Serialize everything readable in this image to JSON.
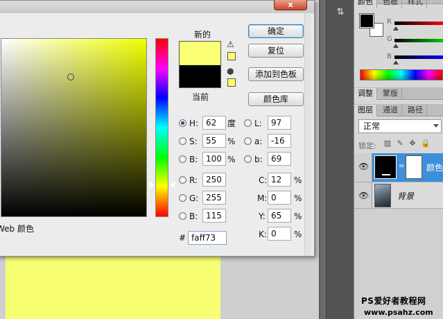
{
  "color_picker": {
    "close_label": "x",
    "new_label": "新的",
    "current_label": "当前",
    "new_color": "#faff73",
    "current_color": "#000000",
    "buttons": {
      "ok": "确定",
      "reset": "复位",
      "add_to_swatches": "添加到色板",
      "color_libraries": "颜色库"
    },
    "hsb": {
      "h_label": "H:",
      "h_value": "62",
      "h_unit": "度",
      "s_label": "S:",
      "s_value": "55",
      "s_unit": "%",
      "b_label": "B:",
      "b_value": "100",
      "b_unit": "%"
    },
    "rgb": {
      "r_label": "R:",
      "r_value": "250",
      "g_label": "G:",
      "g_value": "255",
      "b_label": "B:",
      "b_value": "115"
    },
    "lab": {
      "l_label": "L:",
      "l_value": "97",
      "a_label": "a:",
      "a_value": "-16",
      "b_label": "b:",
      "b_value": "69"
    },
    "cmyk": {
      "c_label": "C:",
      "c_value": "12",
      "c_unit": "%",
      "m_label": "M:",
      "m_value": "0",
      "m_unit": "%",
      "y_label": "Y:",
      "y_value": "65",
      "y_unit": "%",
      "k_label": "K:",
      "k_value": "0",
      "k_unit": "%"
    },
    "hex_label": "#",
    "hex_value": "faff73",
    "web_colors_label": "Web 颜色",
    "selected_mode": "H"
  },
  "panels": {
    "color_tabs": [
      "颜色",
      "色板",
      "样式"
    ],
    "channel_letters": [
      "R",
      "G",
      "B"
    ],
    "adjust_tabs": [
      "调整",
      "蒙版"
    ],
    "layer_tabs": [
      "图层",
      "通道",
      "路径"
    ],
    "blend_mode": "正常",
    "lock_label": "锁定:",
    "layers": [
      {
        "name": "颜色",
        "selected": true
      },
      {
        "name": "背景",
        "selected": false
      }
    ]
  },
  "watermark": {
    "title": "PS爱好者教程网",
    "url": "www.psahz.com"
  }
}
